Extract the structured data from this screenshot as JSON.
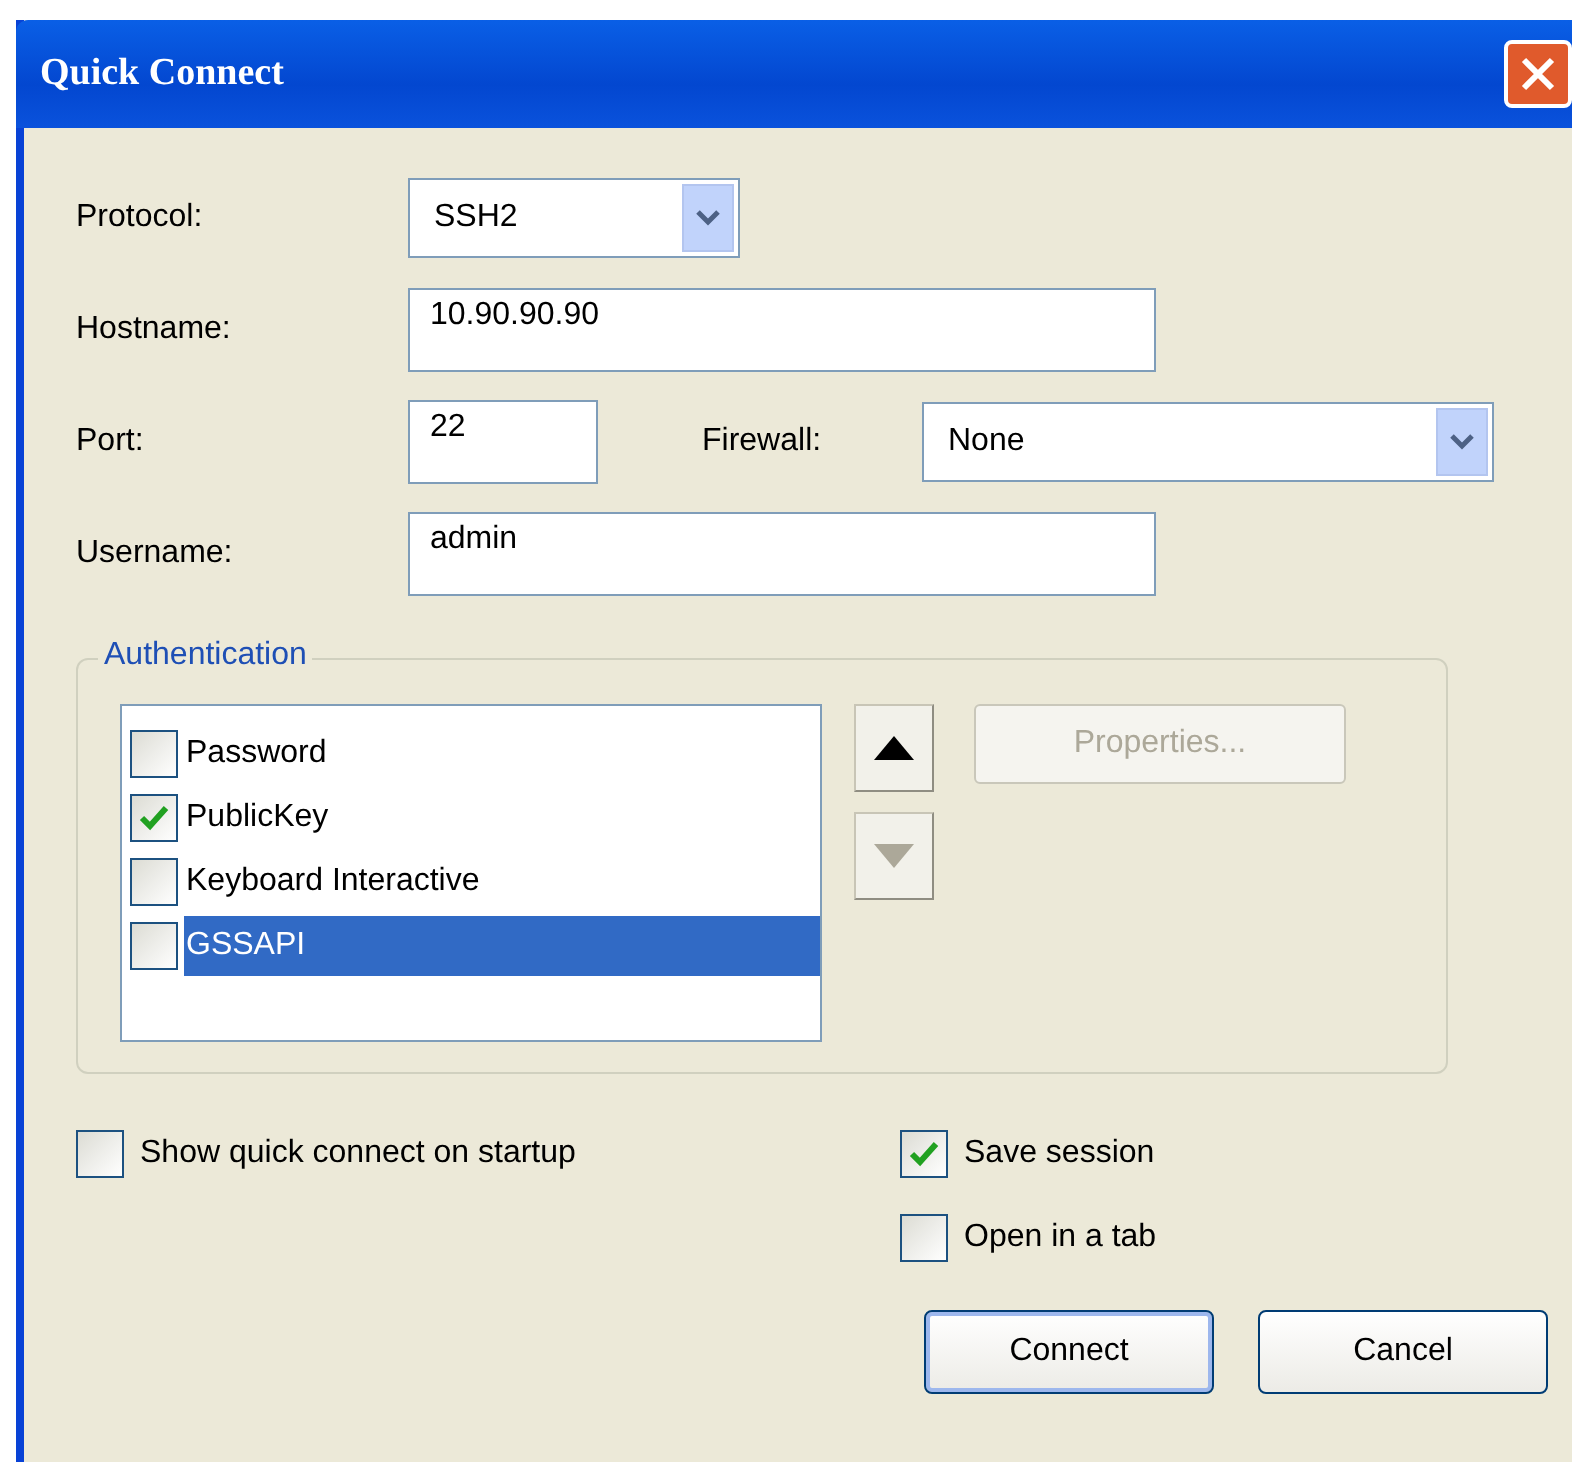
{
  "window": {
    "title": "Quick Connect"
  },
  "protocol": {
    "label": "Protocol:",
    "value": "SSH2"
  },
  "hostname": {
    "label": "Hostname:",
    "value": "10.90.90.90"
  },
  "port": {
    "label": "Port:",
    "value": "22"
  },
  "firewall": {
    "label": "Firewall:",
    "value": "None"
  },
  "username": {
    "label": "Username:",
    "value": "admin"
  },
  "authentication": {
    "title": "Authentication",
    "methods": [
      {
        "label": "Password",
        "checked": false,
        "selected": false
      },
      {
        "label": "PublicKey",
        "checked": true,
        "selected": false
      },
      {
        "label": "Keyboard Interactive",
        "checked": false,
        "selected": false
      },
      {
        "label": "GSSAPI",
        "checked": false,
        "selected": true
      }
    ],
    "move_up": {
      "disabled": false
    },
    "move_down": {
      "disabled": true
    },
    "properties": {
      "label": "Properties...",
      "disabled": true
    }
  },
  "options": [
    {
      "label": "Show quick connect on startup",
      "checked": false
    },
    {
      "label": "Save session",
      "checked": true
    },
    {
      "label": "Open in a tab",
      "checked": false
    }
  ],
  "buttons": [
    {
      "label": "Connect",
      "kind": "default"
    },
    {
      "label": "Cancel",
      "kind": "normal"
    }
  ]
}
